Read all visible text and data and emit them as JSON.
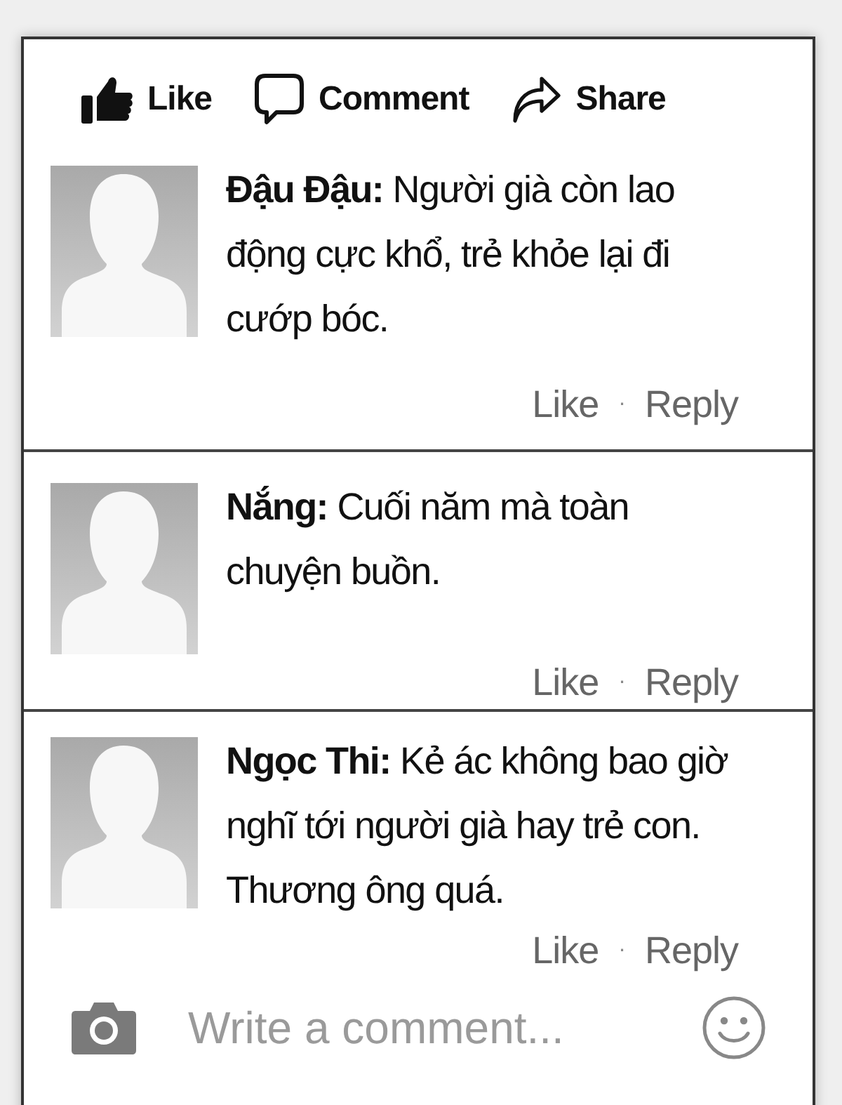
{
  "post_actions": [
    {
      "kind": "like",
      "label": "Like"
    },
    {
      "kind": "comment",
      "label": "Comment"
    },
    {
      "kind": "share",
      "label": "Share"
    }
  ],
  "comments": [
    {
      "text": "**Đậu Đậu:** Người già còn lao động cực khổ, trẻ khỏe lại đi cướp bóc.",
      "like": "Like",
      "separator": "·",
      "reply": "Reply"
    },
    {
      "text": "**Nắng:** Cuối năm mà toàn chuyện buồn.",
      "like": "Like",
      "separator": "·",
      "reply": "Reply"
    },
    {
      "text": "**Ngọc Thi:** Kẻ ác không bao giờ nghĩ tới người già hay trẻ con. Thương ông quá.",
      "like": "Like",
      "separator": "·",
      "reply": "Reply"
    }
  ],
  "composer": {
    "placeholder": "Write a comment..."
  }
}
